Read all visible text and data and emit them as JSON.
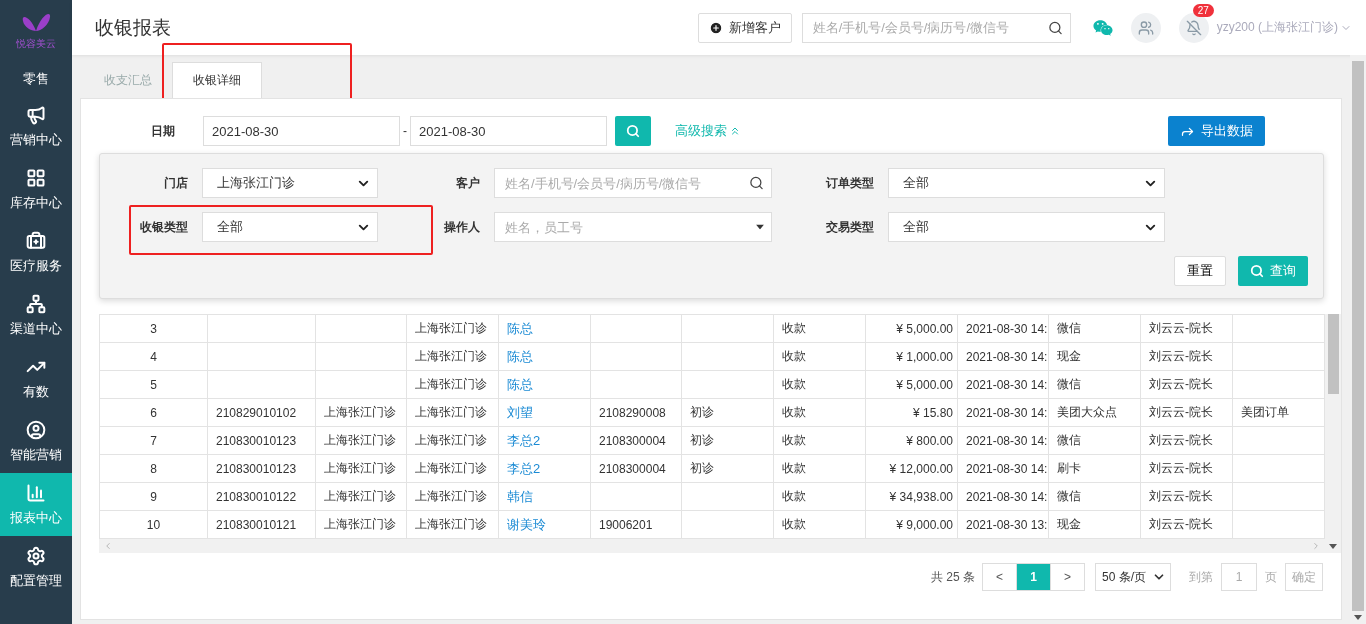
{
  "sidebar": {
    "logo_text": "悦容美云",
    "items": [
      {
        "label": "零售",
        "selected": false
      },
      {
        "label": "营销中心",
        "selected": false
      },
      {
        "label": "库存中心",
        "selected": false
      },
      {
        "label": "医疗服务",
        "selected": false
      },
      {
        "label": "渠道中心",
        "selected": false
      },
      {
        "label": "有数",
        "selected": false
      },
      {
        "label": "智能营销",
        "selected": false
      },
      {
        "label": "报表中心",
        "selected": true
      },
      {
        "label": "配置管理",
        "selected": false
      }
    ]
  },
  "header": {
    "title": "收银报表",
    "add_button": "新增客户",
    "search_placeholder": "姓名/手机号/会员号/病历号/微信号",
    "notification_count": "27",
    "user": "yzy200 (上海张江门诊)"
  },
  "tabs": [
    {
      "label": "收支汇总",
      "selected": false
    },
    {
      "label": "收银详细",
      "selected": true
    }
  ],
  "filters": {
    "date_label": "日期",
    "date_from": "2021-08-30",
    "date_separator": "-",
    "date_to": "2021-08-30",
    "advanced_link": "高级搜索",
    "export_button": "导出数据"
  },
  "advanced_panel": {
    "fields": [
      {
        "label": "门店",
        "kind": "select",
        "value": "上海张江门诊"
      },
      {
        "label": "客户",
        "kind": "search",
        "placeholder": "姓名/手机号/会员号/病历号/微信号"
      },
      {
        "label": "订单类型",
        "kind": "select",
        "value": "全部"
      },
      {
        "label": "收银类型",
        "kind": "select",
        "value": "全部"
      },
      {
        "label": "操作人",
        "kind": "combo",
        "placeholder": "姓名，员工号"
      },
      {
        "label": "交易类型",
        "kind": "select",
        "value": "全部"
      }
    ],
    "reset_button": "重置",
    "query_button": "查询"
  },
  "table": {
    "rows": [
      {
        "column_1": "3",
        "column_4": "上海张江门诊",
        "column_5": "陈总",
        "column_8": "收款",
        "column_9": "¥ 5,000.00",
        "column_10": "2021-08-30 14:",
        "column_11": "微信",
        "column_12": "刘云云-院长"
      },
      {
        "column_1": "4",
        "column_4": "上海张江门诊",
        "column_5": "陈总",
        "column_8": "收款",
        "column_9": "¥ 1,000.00",
        "column_10": "2021-08-30 14:",
        "column_11": "现金",
        "column_12": "刘云云-院长"
      },
      {
        "column_1": "5",
        "column_4": "上海张江门诊",
        "column_5": "陈总",
        "column_8": "收款",
        "column_9": "¥ 5,000.00",
        "column_10": "2021-08-30 14:",
        "column_11": "微信",
        "column_12": "刘云云-院长"
      },
      {
        "column_1": "6",
        "column_2": "210829010102",
        "column_3": "上海张江门诊",
        "column_4": "上海张江门诊",
        "column_5": "刘望",
        "column_6": "2108290008",
        "column_7": "初诊",
        "column_8": "收款",
        "column_9": "¥ 15.80",
        "column_10": "2021-08-30 14:",
        "column_11": "美团大众点",
        "column_12": "刘云云-院长",
        "column_13": "美团订单"
      },
      {
        "column_1": "7",
        "column_2": "210830010123",
        "column_3": "上海张江门诊",
        "column_4": "上海张江门诊",
        "column_5": "李总2",
        "column_6": "2108300004",
        "column_7": "初诊",
        "column_8": "收款",
        "column_9": "¥ 800.00",
        "column_10": "2021-08-30 14:",
        "column_11": "微信",
        "column_12": "刘云云-院长"
      },
      {
        "column_1": "8",
        "column_2": "210830010123",
        "column_3": "上海张江门诊",
        "column_4": "上海张江门诊",
        "column_5": "李总2",
        "column_6": "2108300004",
        "column_7": "初诊",
        "column_8": "收款",
        "column_9": "¥ 12,000.00",
        "column_10": "2021-08-30 14:",
        "column_11": "刷卡",
        "column_12": "刘云云-院长"
      },
      {
        "column_1": "9",
        "column_2": "210830010122",
        "column_3": "上海张江门诊",
        "column_4": "上海张江门诊",
        "column_5": "韩信",
        "column_8": "收款",
        "column_9": "¥ 34,938.00",
        "column_10": "2021-08-30 14:",
        "column_11": "微信",
        "column_12": "刘云云-院长"
      },
      {
        "column_1": "10",
        "column_2": "210830010121",
        "column_3": "上海张江门诊",
        "column_4": "上海张江门诊",
        "column_5": "谢美玲",
        "column_6": "19006201",
        "column_8": "收款",
        "column_9": "¥ 9,000.00",
        "column_10": "2021-08-30 13:",
        "column_11": "现金",
        "column_12": "刘云云-院长"
      }
    ]
  },
  "pagination": {
    "total": "共 25 条",
    "prev": "<",
    "pages": [
      {
        "label": "1",
        "selected": true
      }
    ],
    "next": ">",
    "page_size": "50 条/页",
    "goto_label": "到第",
    "goto_value": "1",
    "page_unit": "页",
    "confirm_button": "确定"
  }
}
